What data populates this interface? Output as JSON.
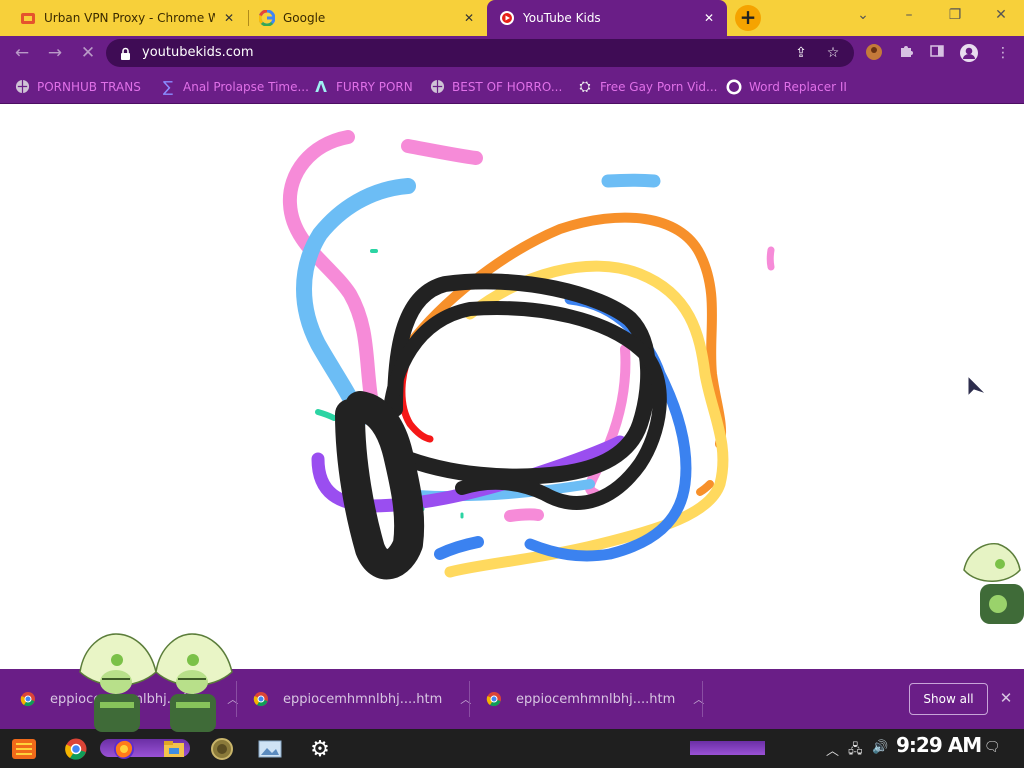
{
  "tabs": [
    {
      "title": "Urban VPN Proxy - Chrome We",
      "active": false
    },
    {
      "title": "Google",
      "active": false
    },
    {
      "title": "YouTube Kids",
      "active": true
    }
  ],
  "omnibox": {
    "url": "youtubekids.com"
  },
  "bookmarks": [
    {
      "label": "PORNHUB TRANS",
      "icon": "globe-icon"
    },
    {
      "label": "Anal Prolapse Time...",
      "icon": "sigma-icon"
    },
    {
      "label": "FURRY PORN",
      "icon": "lambda-icon"
    },
    {
      "label": "BEST OF HORRO...",
      "icon": "globe-icon"
    },
    {
      "label": "Free Gay Porn Vid...",
      "icon": "badge-icon"
    },
    {
      "label": "Word Replacer II",
      "icon": "wr-icon"
    }
  ],
  "downloads": {
    "items": [
      {
        "filename": "eppiocemhmnlbhj....htm"
      },
      {
        "filename": "eppiocemhmnlbhj....htm"
      },
      {
        "filename": "eppiocemhmnlbhj....htm"
      }
    ],
    "show_all_label": "Show all"
  },
  "taskbar": {
    "clock": "9:29 AM"
  },
  "colors": {
    "tab_strip": "#f7d03a",
    "toolbar": "#6a1e87",
    "bookmark_text": "#e070e8",
    "taskbar": "#1f1f1f"
  }
}
